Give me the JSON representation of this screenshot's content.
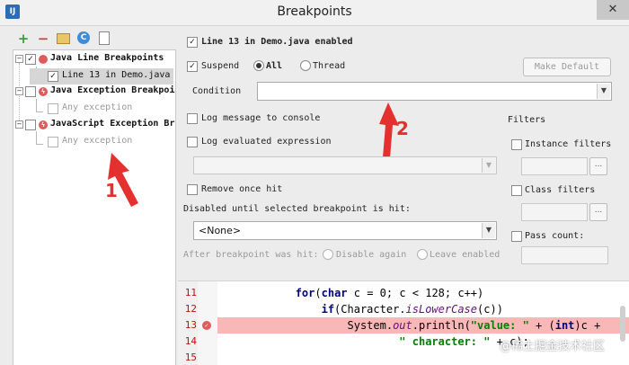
{
  "window": {
    "title": "Breakpoints",
    "app_icon": "IJ"
  },
  "toolbar": {
    "add": "+",
    "remove": "−"
  },
  "tree": [
    {
      "label": "Java Line Breakpoints",
      "checked": true
    },
    {
      "label": "Line 13 in Demo.java",
      "checked": true
    },
    {
      "label": "Java Exception Breakpoi",
      "checked": false
    },
    {
      "label": "Any exception",
      "checked": false
    },
    {
      "label": "JavaScript Exception Br",
      "checked": false
    },
    {
      "label": "Any exception",
      "checked": false
    }
  ],
  "details": {
    "header": "Line 13 in Demo.java enabled",
    "suspend": "Suspend",
    "all": "All",
    "thread": "Thread",
    "make_default": "Make Default",
    "condition": "Condition",
    "log_message": "Log message to console",
    "log_expression": "Log evaluated expression",
    "remove_once_hit": "Remove once hit",
    "disabled_until": "Disabled until selected breakpoint is hit:",
    "none_option": "<None>",
    "after_hit": "After breakpoint was hit:",
    "disable_again": "Disable again",
    "leave_enabled": "Leave enabled",
    "filters": "Filters",
    "instance_filters": "Instance filters",
    "class_filters": "Class filters",
    "pass_count": "Pass count:",
    "dots": "..."
  },
  "code": {
    "lines": [
      {
        "num": "11",
        "parts": [
          {
            "t": "            "
          },
          {
            "t": "for",
            "c": "kw"
          },
          {
            "t": "("
          },
          {
            "t": "char",
            "c": "kw"
          },
          {
            "t": " c = 0; c < 128; c++)"
          }
        ]
      },
      {
        "num": "12",
        "parts": [
          {
            "t": "                "
          },
          {
            "t": "if",
            "c": "kw"
          },
          {
            "t": "(Character."
          },
          {
            "t": "isLowerCase",
            "c": "it"
          },
          {
            "t": "(c))"
          }
        ]
      },
      {
        "num": "13",
        "parts": [
          {
            "t": "                    System."
          },
          {
            "t": "out",
            "c": "it"
          },
          {
            "t": ".println("
          },
          {
            "t": "\"value: \"",
            "c": "str"
          },
          {
            "t": " + ("
          },
          {
            "t": "int",
            "c": "kw"
          },
          {
            "t": ")c +"
          }
        ]
      },
      {
        "num": "14",
        "parts": [
          {
            "t": "                            "
          },
          {
            "t": "\" character: \"",
            "c": "str"
          },
          {
            "t": " + c);"
          }
        ]
      },
      {
        "num": "15",
        "parts": [
          {
            "t": ""
          }
        ]
      }
    ]
  },
  "annotations": {
    "one": "1",
    "two": "2"
  },
  "watermark": "@稀土掘金技术社区",
  "colors": {
    "highlight": "#f9b8b8",
    "breakpoint": "#e05b5b",
    "annotation": "#e53030"
  }
}
